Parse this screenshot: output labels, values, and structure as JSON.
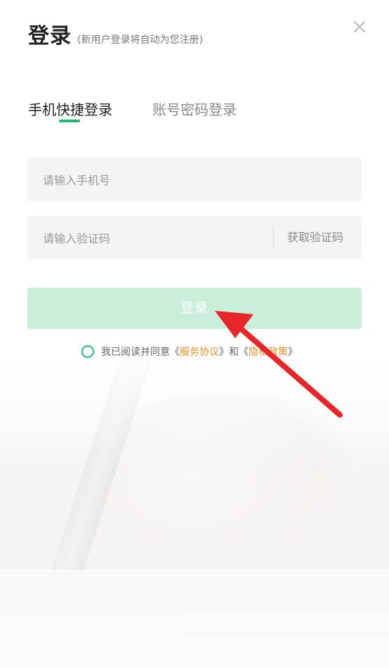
{
  "header": {
    "title": "登录",
    "subtitle": "(新用户登录将自动为您注册)",
    "close_icon": "close-icon"
  },
  "tabs": [
    {
      "label": "手机快捷登录",
      "active": true
    },
    {
      "label": "账号密码登录",
      "active": false
    }
  ],
  "form": {
    "phone_placeholder": "请输入手机号",
    "phone_value": "",
    "code_placeholder": "请输入验证码",
    "code_value": "",
    "get_code_label": "获取验证码",
    "login_label": "登录"
  },
  "agreement": {
    "prefix": "我已阅读并同意",
    "open_quote": "《",
    "service_link": "服务协议",
    "close_quote": "》",
    "and": "和",
    "privacy_link": "隐私政策",
    "checked": false
  },
  "colors": {
    "accent": "#21b96b",
    "button_disabled": "#c9efdb",
    "link": "#e8912a",
    "annotation_arrow": "#e8262a"
  }
}
